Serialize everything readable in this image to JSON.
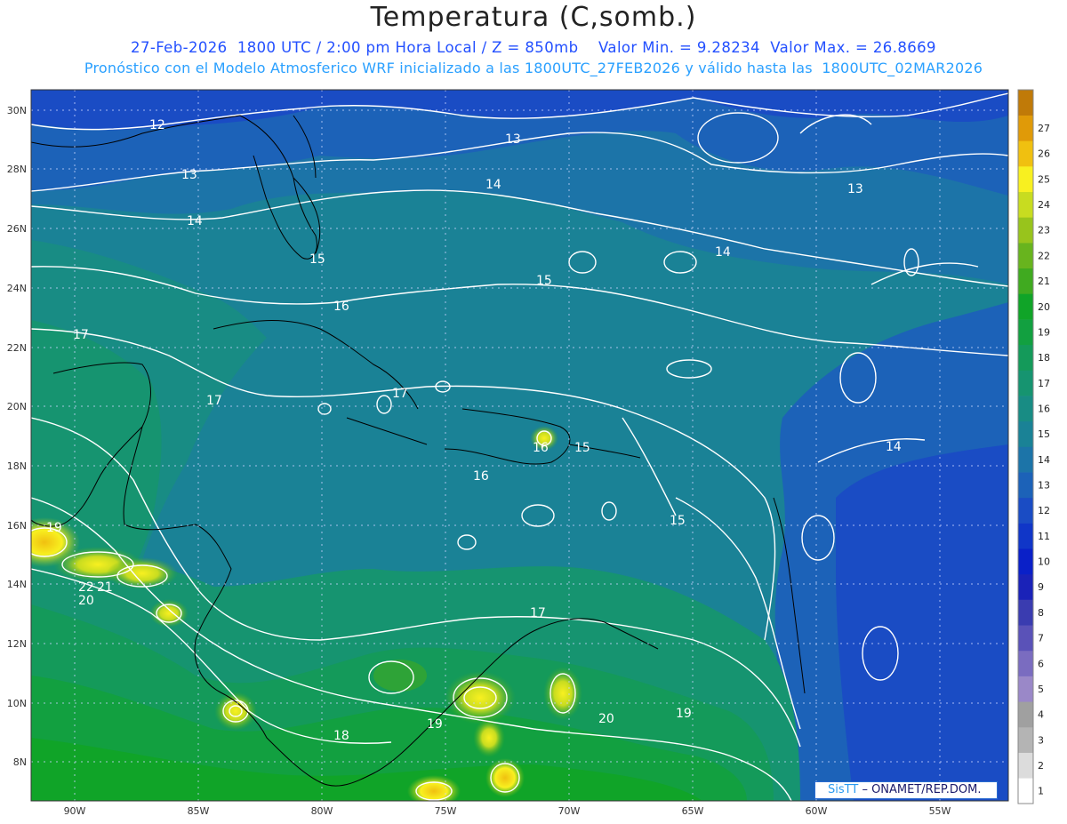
{
  "title": "Temperatura (C,somb.)",
  "subtitle_line1": "27-Feb-2026  1800 UTC / 2:00 pm Hora Local / Z = 850mb    Valor Min. = 9.28234  Valor Max. = 26.8669",
  "subtitle_line2": "Pronóstico con el Modelo Atmosferico WRF inicializado a las 1800UTC_27FEB2026 y válido hasta las  1800UTC_02MAR2026",
  "lat_ticks": [
    "30N",
    "28N",
    "26N",
    "24N",
    "22N",
    "20N",
    "18N",
    "16N",
    "14N",
    "12N",
    "10N",
    "8N"
  ],
  "lon_ticks": [
    "90W",
    "85W",
    "80W",
    "75W",
    "70W",
    "65W",
    "60W",
    "55W"
  ],
  "contour_labels": [
    "12",
    "13",
    "13",
    "14",
    "14",
    "13",
    "14",
    "15",
    "15",
    "16",
    "17",
    "17",
    "17",
    "16",
    "16",
    "15",
    "15",
    "14",
    "19",
    "22",
    "21",
    "20",
    "17",
    "18",
    "19",
    "20",
    "19"
  ],
  "colorbar": {
    "labels": [
      "1",
      "2",
      "3",
      "4",
      "5",
      "6",
      "7",
      "8",
      "9",
      "10",
      "11",
      "12",
      "13",
      "14",
      "15",
      "16",
      "17",
      "18",
      "19",
      "20",
      "21",
      "22",
      "23",
      "24",
      "25",
      "26",
      "27"
    ],
    "colors": [
      "#ffffff",
      "#dcdcdc",
      "#b4b4b4",
      "#a0a0a0",
      "#9a88c8",
      "#7a6cc0",
      "#5a52b8",
      "#3a3cb0",
      "#1a22b8",
      "#0a20c8",
      "#1036c8",
      "#1a4cc4",
      "#1c62b8",
      "#1c74a8",
      "#1a8296",
      "#188c84",
      "#169470",
      "#149a5a",
      "#12a040",
      "#10a428",
      "#40aa20",
      "#68b41e",
      "#98c41c",
      "#c8dc20",
      "#f8f020",
      "#f0c010",
      "#e09a08",
      "#c07a08"
    ]
  },
  "credit": {
    "brand": "SisTT",
    "text": "– ONAMET/REP.DOM."
  }
}
